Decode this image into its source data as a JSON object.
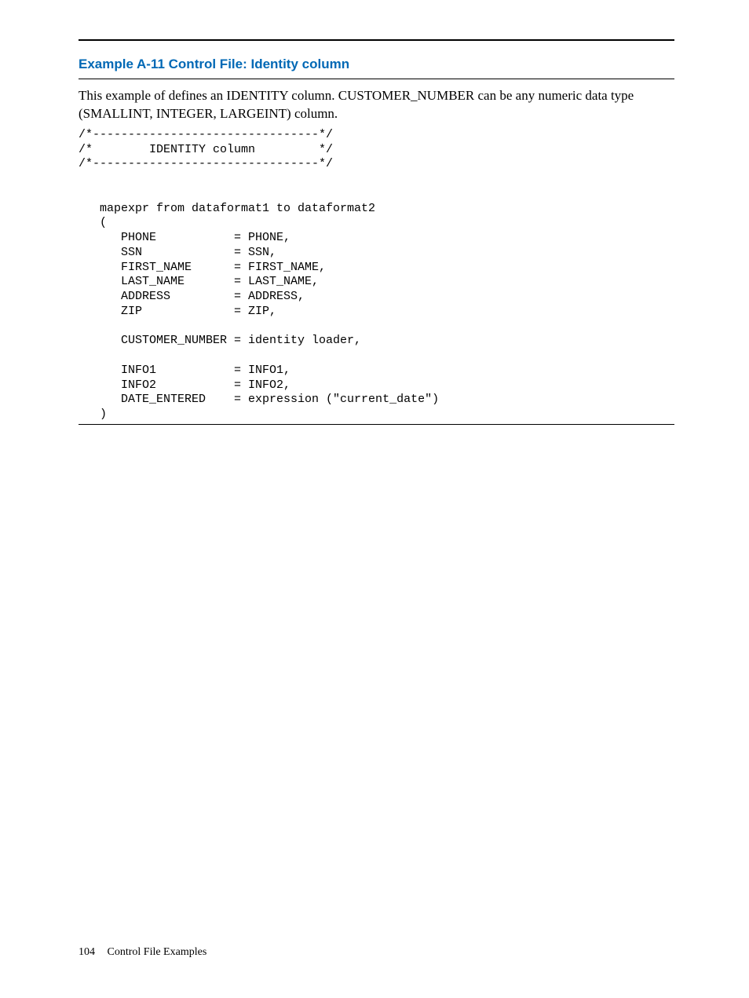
{
  "example": {
    "title": "Example A-11 Control File: Identity column",
    "description": "This example of defines an IDENTITY column. CUSTOMER_NUMBER can be any numeric data type (SMALLINT, INTEGER, LARGEINT) column.",
    "code": "/*--------------------------------*/\n/*        IDENTITY column         */\n/*--------------------------------*/\n\n\n   mapexpr from dataformat1 to dataformat2\n   (\n      PHONE           = PHONE,\n      SSN             = SSN,\n      FIRST_NAME      = FIRST_NAME,\n      LAST_NAME       = LAST_NAME,\n      ADDRESS         = ADDRESS,\n      ZIP             = ZIP,\n\n      CUSTOMER_NUMBER = identity loader,\n\n      INFO1           = INFO1,\n      INFO2           = INFO2,\n      DATE_ENTERED    = expression (\"current_date\")\n   )"
  },
  "footer": {
    "page_number": "104",
    "section": "Control File Examples"
  }
}
